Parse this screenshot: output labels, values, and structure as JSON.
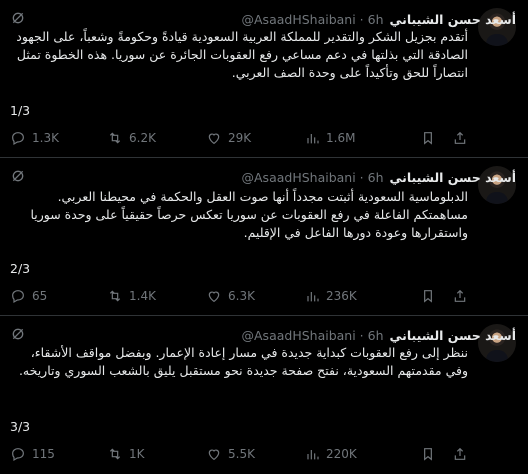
{
  "tweets": [
    {
      "name": "أسعد حسن الشيباني",
      "handle": "@AsaadHShaibani",
      "time": "6h",
      "text": "أتقدم بجزيل الشكر والتقدير للمملكة العربية السعودية قيادةً وحكومةً وشعباً، على الجهود الصادقة التي بذلتها في دعم مساعي رفع العقوبات الجائرة عن سوريا. هذه الخطوة تمثل انتصاراً للحق وتأكيداً على وحدة الصف العربي.",
      "counter": "1/3",
      "stats": {
        "replies": "1.3K",
        "reposts": "6.2K",
        "likes": "29K",
        "views": "1.6M"
      }
    },
    {
      "name": "أسعد حسن الشيباني",
      "handle": "@AsaadHShaibani",
      "time": "6h",
      "text": "الدبلوماسية السعودية أثبتت مجدداً أنها صوت العقل والحكمة في محيطنا العربي. مساهمتكم الفاعلة في رفع العقوبات عن سوريا تعكس حرصاً حقيقياً على وحدة سوريا واستقرارها وعودة دورها الفاعل في الإقليم.",
      "counter": "2/3",
      "stats": {
        "replies": "65",
        "reposts": "1.4K",
        "likes": "6.3K",
        "views": "236K"
      }
    },
    {
      "name": "أسعد حسن الشيباني",
      "handle": "@AsaadHShaibani",
      "time": "6h",
      "text": "ننظر إلى رفع العقوبات كبداية جديدة في مسار إعادة الإعمار. وبفضل مواقف الأشقاء، وفي مقدمتهم السعودية، نفتح صفحة جديدة نحو مستقبل يليق بالشعب السوري وتاريخه.",
      "counter": "3/3",
      "stats": {
        "replies": "115",
        "reposts": "1K",
        "likes": "5.5K",
        "views": "220K"
      }
    }
  ],
  "colors": {
    "background": "#000000",
    "text": "#e7e9ea",
    "muted": "#71767b",
    "divider": "#2f3336"
  },
  "icons": [
    "grok-icon",
    "reply-icon",
    "repost-icon",
    "like-icon",
    "views-icon",
    "bookmark-icon",
    "share-icon"
  ]
}
